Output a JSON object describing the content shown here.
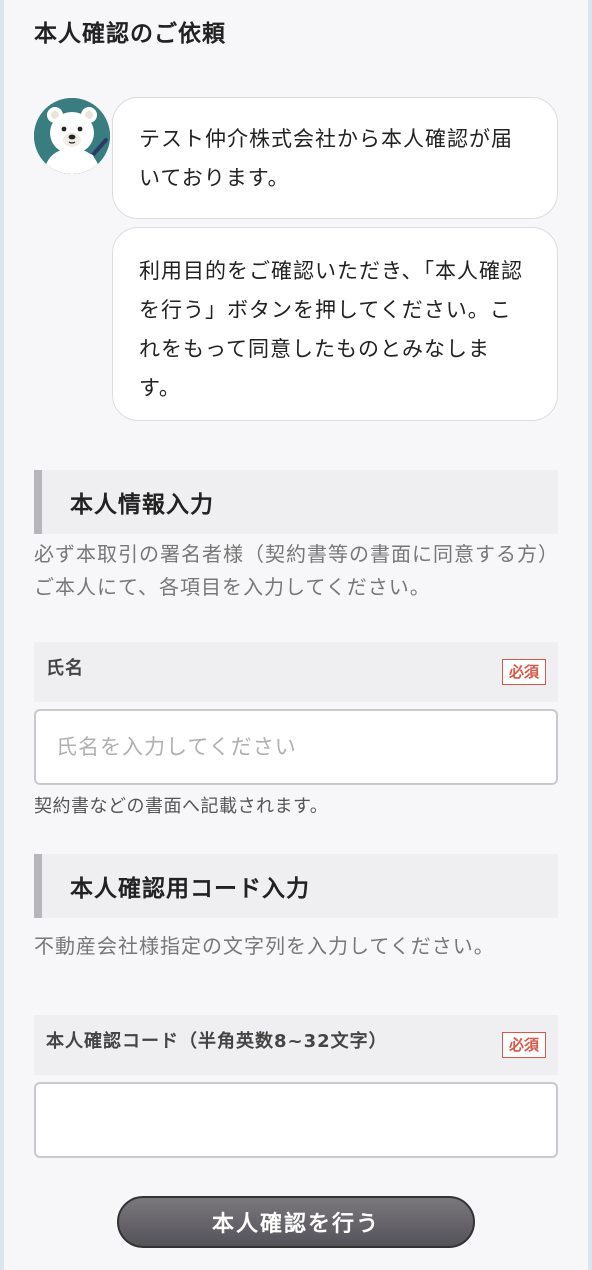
{
  "header": {
    "title": "本人確認のご依頼"
  },
  "chat": {
    "avatar_icon": "polar-bear-writing-icon",
    "messages": [
      "テスト仲介株式会社から本人確認が届いております。",
      "利用目的をご確認いただき、「本人確認を行う」ボタンを押してください。これをもって同意したものとみなします。"
    ]
  },
  "personal_info": {
    "title": "本人情報入力",
    "description": "必ず本取引の署名者様（契約書等の書面に同意する方）ご本人にて、各項目を入力してください。",
    "name_label": "氏名",
    "required_label": "必須",
    "name_placeholder": "氏名を入力してください",
    "name_value": "",
    "name_hint": "契約書などの書面へ記載されます。"
  },
  "code_input": {
    "title": "本人確認用コード入力",
    "description": "不動産会社様指定の文字列を入力してください。",
    "code_label": "本人確認コード（半角英数8~32文字）",
    "required_label": "必須",
    "code_value": ""
  },
  "submit": {
    "label": "本人確認を行う"
  },
  "colors": {
    "accent_red": "#d9584a",
    "avatar_bg": "#3a7d80",
    "button": "#5f5d63"
  }
}
